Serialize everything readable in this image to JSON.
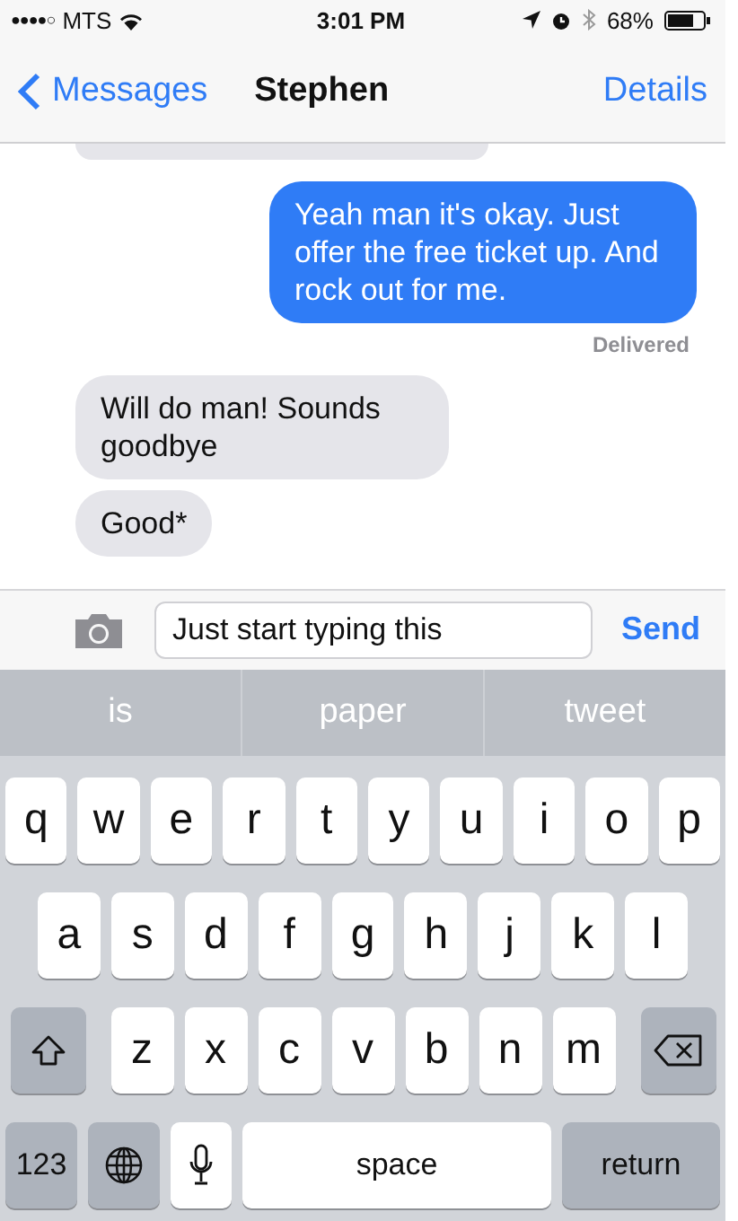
{
  "status_bar": {
    "signal": "●●●●○",
    "carrier": "MTS",
    "time": "3:01 PM",
    "battery": "68%"
  },
  "nav": {
    "back": "Messages",
    "title": "Stephen",
    "action": "Details"
  },
  "messages": [
    {
      "kind": "clipped"
    },
    {
      "kind": "sent",
      "text": "Yeah man it's okay. Just offer the free ticket up. And rock out for me.",
      "status": "Delivered"
    },
    {
      "kind": "received",
      "text": "Will do man! Sounds goodbye"
    },
    {
      "kind": "received",
      "text": "Good*"
    }
  ],
  "composer": {
    "value": "Just start typing this",
    "send": "Send"
  },
  "suggestions": [
    "is",
    "paper",
    "tweet"
  ],
  "keyboard": [
    [
      {
        "kind": "letter",
        "label": "q"
      },
      {
        "kind": "letter",
        "label": "w"
      },
      {
        "kind": "letter",
        "label": "e"
      },
      {
        "kind": "letter",
        "label": "r"
      },
      {
        "kind": "letter",
        "label": "t"
      },
      {
        "kind": "letter",
        "label": "y"
      },
      {
        "kind": "letter",
        "label": "u"
      },
      {
        "kind": "letter",
        "label": "i"
      },
      {
        "kind": "letter",
        "label": "o"
      },
      {
        "kind": "letter",
        "label": "p"
      }
    ],
    [
      {
        "kind": "letter",
        "label": "a"
      },
      {
        "kind": "letter",
        "label": "s"
      },
      {
        "kind": "letter",
        "label": "d"
      },
      {
        "kind": "letter",
        "label": "f"
      },
      {
        "kind": "letter",
        "label": "g"
      },
      {
        "kind": "letter",
        "label": "h"
      },
      {
        "kind": "letter",
        "label": "j"
      },
      {
        "kind": "letter",
        "label": "k"
      },
      {
        "kind": "letter",
        "label": "l"
      }
    ],
    [
      {
        "kind": "shift"
      },
      {
        "kind": "letter",
        "label": "z"
      },
      {
        "kind": "letter",
        "label": "x"
      },
      {
        "kind": "letter",
        "label": "c"
      },
      {
        "kind": "letter",
        "label": "v"
      },
      {
        "kind": "letter",
        "label": "b"
      },
      {
        "kind": "letter",
        "label": "n"
      },
      {
        "kind": "letter",
        "label": "m"
      },
      {
        "kind": "delete"
      }
    ],
    [
      {
        "kind": "numbers",
        "label": "123"
      },
      {
        "kind": "globe"
      },
      {
        "kind": "mic"
      },
      {
        "kind": "space",
        "label": "space"
      },
      {
        "kind": "return",
        "label": "return"
      }
    ]
  ]
}
